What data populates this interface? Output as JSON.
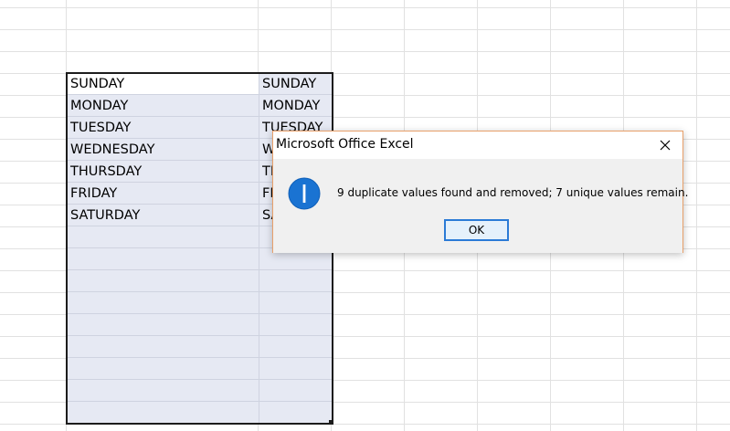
{
  "sheet": {
    "columnA": [
      "SUNDAY",
      "MONDAY",
      "TUESDAY",
      "WEDNESDAY",
      "THURSDAY",
      "FRIDAY",
      "SATURDAY"
    ],
    "columnB": [
      "SUNDAY",
      "MONDAY",
      "TUESDAY",
      "WEDNESDAY",
      "THURSDAY",
      "FRIDAY",
      "SATURDAY"
    ]
  },
  "dialog": {
    "title": "Microsoft Office Excel",
    "message": "9 duplicate values found and removed; 7 unique values remain.",
    "ok_label": "OK",
    "close_icon": "close-icon",
    "info_icon": "info-icon",
    "accent_color": "#1a73d2",
    "border_color": "#e8a06a"
  }
}
